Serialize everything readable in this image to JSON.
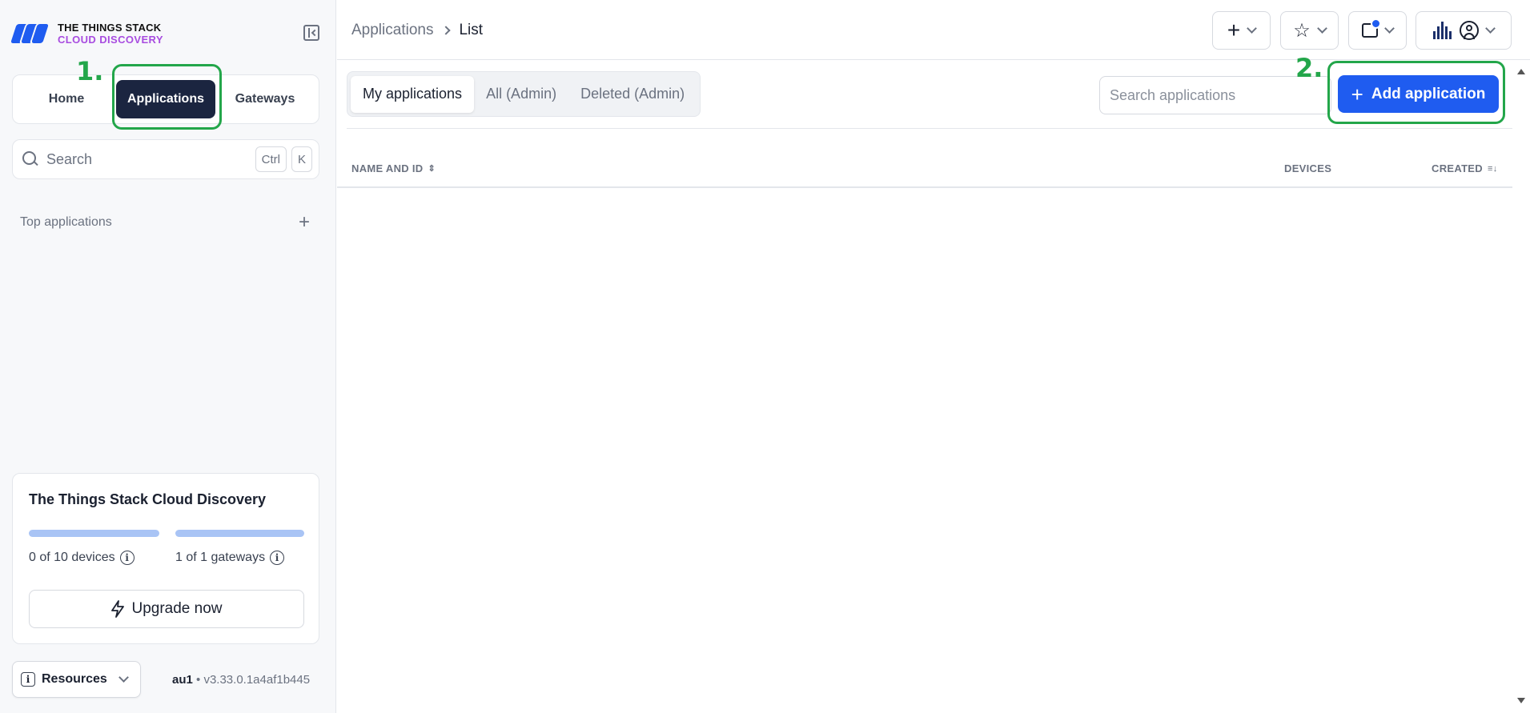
{
  "brand": {
    "line1": "THE THINGS STACK",
    "line2": "CLOUD DISCOVERY"
  },
  "sidebar": {
    "nav": [
      {
        "label": "Home"
      },
      {
        "label": "Applications"
      },
      {
        "label": "Gateways"
      }
    ],
    "search": {
      "placeholder": "Search",
      "shortcut_keys": [
        "Ctrl",
        "K"
      ]
    },
    "top_applications": {
      "label": "Top applications"
    },
    "plan_card": {
      "title": "The Things Stack Cloud Discovery",
      "usage": [
        {
          "text": "0 of 10 devices",
          "fraction": 0.0
        },
        {
          "text": "1 of 1 gateways",
          "fraction": 1.0
        }
      ],
      "upgrade_label": "Upgrade now"
    },
    "resources_label": "Resources",
    "cluster": "au1",
    "version": "v3.33.0.1a4af1b445"
  },
  "topbar": {
    "breadcrumb": [
      "Applications",
      "List"
    ]
  },
  "main": {
    "filter_tabs": [
      {
        "label": "My applications"
      },
      {
        "label": "All (Admin)"
      },
      {
        "label": "Deleted (Admin)"
      }
    ],
    "search_placeholder": "Search applications",
    "add_button_label": "Add application",
    "table": {
      "columns": [
        "NAME AND ID",
        "DEVICES",
        "CREATED"
      ],
      "rows": []
    }
  },
  "annotations": {
    "step1": "1.",
    "step2": "2."
  },
  "colors": {
    "accent": "#1f5cf0",
    "nav_active": "#1b2540",
    "brand_purple": "#a84ce0",
    "annotation_green": "#23a64a"
  }
}
